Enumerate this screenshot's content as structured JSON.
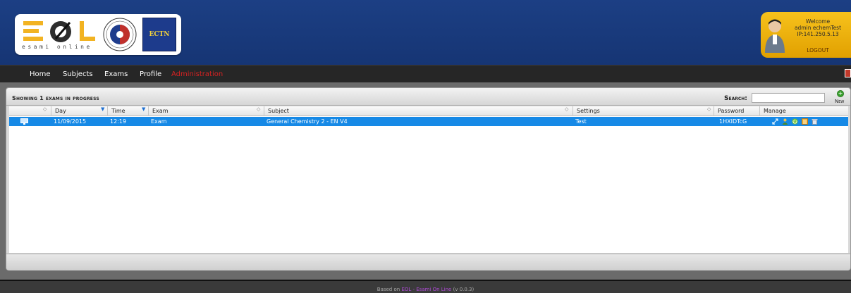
{
  "header": {
    "logo_subtitle": "esami online",
    "ectn_label": "ECTN",
    "welcome": {
      "greeting": "Welcome",
      "user": "admin echemTest",
      "ip": "IP:141.250.5.13",
      "logout": "LOGOUT"
    }
  },
  "nav": {
    "items": [
      "Home",
      "Subjects",
      "Exams",
      "Profile",
      "Administration"
    ],
    "active_color": "#d42222"
  },
  "panel": {
    "title": "Showing 1 exams in progress",
    "search_label": "Search:",
    "search_value": "",
    "new_label": "New"
  },
  "table": {
    "columns": [
      "Day",
      "Time",
      "Exam",
      "Subject",
      "Settings",
      "Password",
      "Manage"
    ],
    "rows": [
      {
        "day": "11/09/2015",
        "time": "12:19",
        "exam": "Exam",
        "subject": "General Chemistry 2 - EN V4",
        "settings": "Test",
        "password": "1HXIDTcG",
        "manage_icons": [
          "resize-icon",
          "user-icon",
          "power-icon",
          "list-icon",
          "trash-icon"
        ]
      }
    ],
    "selected_row_color": "#1689e6"
  },
  "footer": {
    "prefix": "Based on",
    "link": "EOL - Esami On Line",
    "version": "(v 0.0.3)"
  }
}
